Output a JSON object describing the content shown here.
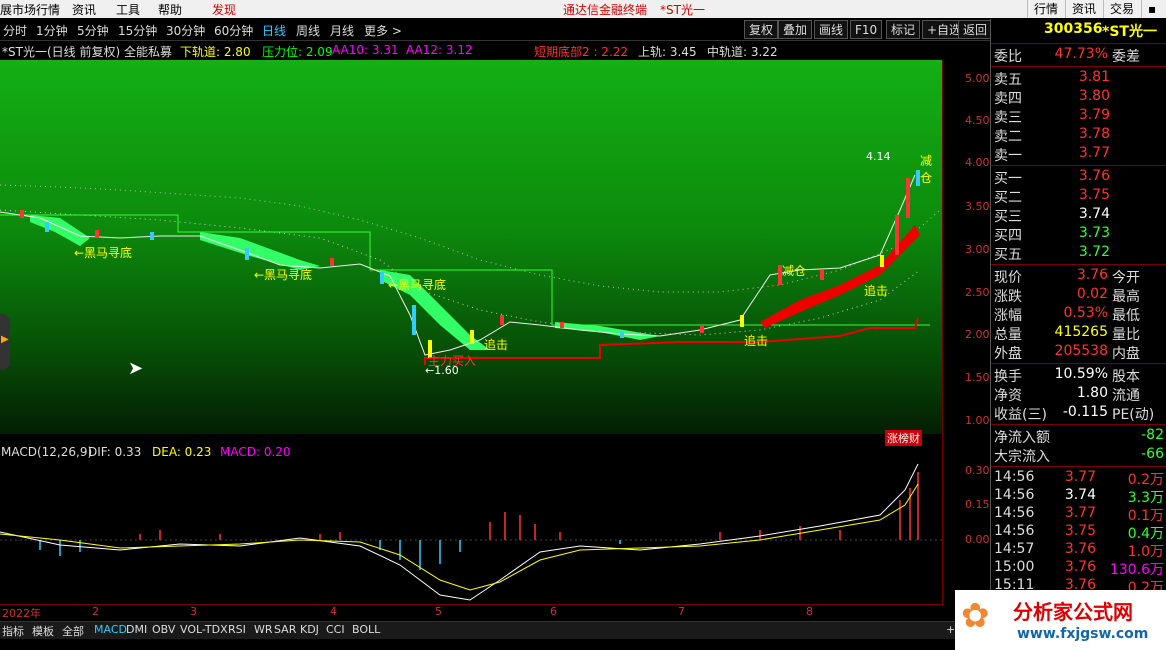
{
  "menu": {
    "items": [
      "展市场行情",
      "资讯",
      "工具",
      "帮助"
    ],
    "discover": "发现",
    "terminal_title": "通达信金融终端",
    "stock_tag": "*ST光一",
    "right_buttons": [
      "行情",
      "资讯",
      "交易"
    ]
  },
  "tabs": {
    "periods": [
      "分时",
      "1分钟",
      "5分钟",
      "15分钟",
      "30分钟",
      "60分钟",
      "日线",
      "周线",
      "月线",
      "更多 >"
    ],
    "active": "日线",
    "buttons": [
      "复权",
      "叠加",
      "画线",
      "F10",
      "标记",
      "+自选",
      "返回"
    ]
  },
  "info": {
    "title": "*ST光一(日线 前复权) 全能私募",
    "xgd": "下轨道: 2.80",
    "ylw": "压力位: 2.09",
    "aa10": "AA10: 3.31",
    "aa12": "AA12: 3.12",
    "dqdb": "短期底部2 : 2.22",
    "sg": "上轨: 3.45",
    "zgd": "中轨道: 3.22"
  },
  "annotations": {
    "hmxd": "←黑马寻底",
    "low": "←1.60",
    "zhuijin": "追击",
    "high": "4.14",
    "jiancang": "减仓",
    "buy": "主力买入",
    "zhangbang": "涨榜财"
  },
  "price_axis": [
    "5.00",
    "4.50",
    "4.00",
    "3.50",
    "3.00",
    "2.50",
    "2.00",
    "1.50",
    "1.00"
  ],
  "macd": {
    "title": "MACD(12,26,9)",
    "dif": "DIF: 0.33",
    "dea": "DEA: 0.23",
    "macd": "MACD: 0.20",
    "axis": [
      "0.30",
      "0.15",
      "0.00"
    ]
  },
  "dates": [
    "2022年",
    "2",
    "3",
    "4",
    "5",
    "6",
    "7",
    "8"
  ],
  "bottom_tabs": [
    "指标",
    "模板",
    "全部",
    "MACD",
    "DMI",
    "OBV",
    "VOL-TDX",
    "RSI",
    "WR",
    "SAR",
    "KDJ",
    "CCI",
    "BOLL"
  ],
  "bottom_active": "MACD",
  "quote": {
    "code": "300356",
    "name": "*ST光一",
    "weibi_label": "委比",
    "weibi": "47.73%",
    "weicha_label": "委差",
    "asks": [
      {
        "label": "卖五",
        "price": "3.81"
      },
      {
        "label": "卖四",
        "price": "3.80"
      },
      {
        "label": "卖三",
        "price": "3.79"
      },
      {
        "label": "卖二",
        "price": "3.78"
      },
      {
        "label": "卖一",
        "price": "3.77"
      }
    ],
    "bids": [
      {
        "label": "买一",
        "price": "3.76"
      },
      {
        "label": "买二",
        "price": "3.75"
      },
      {
        "label": "买三",
        "price": "3.74"
      },
      {
        "label": "买四",
        "price": "3.73"
      },
      {
        "label": "买五",
        "price": "3.72"
      }
    ],
    "stats": [
      {
        "l1": "现价",
        "v1": "3.76",
        "l2": "今开"
      },
      {
        "l1": "涨跌",
        "v1": "0.02",
        "l2": "最高"
      },
      {
        "l1": "涨幅",
        "v1": "0.53%",
        "l2": "最低"
      },
      {
        "l1": "总量",
        "v1": "415265",
        "l2": "量比"
      },
      {
        "l1": "外盘",
        "v1": "205538",
        "l2": "内盘"
      }
    ],
    "stats2": [
      {
        "l1": "换手",
        "v1": "10.59%",
        "l2": "股本"
      },
      {
        "l1": "净资",
        "v1": "1.80",
        "l2": "流通"
      },
      {
        "l1": "收益(三)",
        "v1": "-0.115",
        "l2": "PE(动)"
      }
    ],
    "flows": [
      {
        "label": "净流入额",
        "val": "-82"
      },
      {
        "label": "大宗流入",
        "val": "-66"
      }
    ],
    "ticks": [
      {
        "time": "14:56",
        "price": "3.77",
        "vol": "0.2万"
      },
      {
        "time": "14:56",
        "price": "3.74",
        "vol": "3.3万"
      },
      {
        "time": "14:56",
        "price": "3.77",
        "vol": "0.1万"
      },
      {
        "time": "14:56",
        "price": "3.75",
        "vol": "0.4万"
      },
      {
        "time": "14:57",
        "price": "3.76",
        "vol": "1.0万"
      },
      {
        "time": "15:00",
        "price": "3.76",
        "vol": "130.6万"
      },
      {
        "time": "15:11",
        "price": "3.76",
        "vol": "0.2万"
      }
    ]
  },
  "watermark": {
    "title": "分析家公式网",
    "url": "www.fxjgsw.com"
  }
}
